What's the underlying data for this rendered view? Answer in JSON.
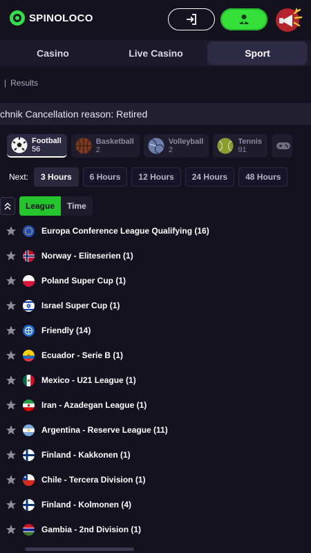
{
  "header": {
    "brand": "SPINOLOCO"
  },
  "nav": {
    "tabs": [
      {
        "label": "Casino"
      },
      {
        "label": "Live Casino"
      },
      {
        "label": "Sport"
      }
    ],
    "active": "Sport"
  },
  "breadcrumb": {
    "prev": "",
    "sep": "|",
    "current": "Results"
  },
  "ticker": {
    "text": "chnik Cancellation reason: Retired"
  },
  "sports": [
    {
      "name": "Football",
      "count": "56",
      "icon": "football-icon"
    },
    {
      "name": "Basketball",
      "count": "2",
      "icon": "basketball-icon"
    },
    {
      "name": "Volleyball",
      "count": "2",
      "icon": "volleyball-icon"
    },
    {
      "name": "Tennis",
      "count": "91",
      "icon": "tennis-icon"
    }
  ],
  "filter": {
    "next_label": "Next:",
    "options": [
      "3 Hours",
      "6 Hours",
      "12 Hours",
      "24 Hours",
      "48 Hours"
    ],
    "active": "3 Hours"
  },
  "sort": {
    "options": [
      "League",
      "Time"
    ],
    "active": "League"
  },
  "leagues": [
    {
      "name": "Europa Conference League Qualifying (16)",
      "flag": "eu-flag-icon"
    },
    {
      "name": "Norway - Eliteserien (1)",
      "flag": "norway-flag-icon"
    },
    {
      "name": "Poland Super Cup (1)",
      "flag": "poland-flag-icon"
    },
    {
      "name": "Israel Super Cup (1)",
      "flag": "israel-flag-icon"
    },
    {
      "name": "Friendly (14)",
      "flag": "world-icon"
    },
    {
      "name": "Ecuador - Serie B (1)",
      "flag": "ecuador-flag-icon"
    },
    {
      "name": "Mexico - U21 League (1)",
      "flag": "mexico-flag-icon"
    },
    {
      "name": "Iran - Azadegan League (1)",
      "flag": "iran-flag-icon"
    },
    {
      "name": "Argentina - Reserve League (11)",
      "flag": "argentina-flag-icon"
    },
    {
      "name": "Finland - Kakkonen (1)",
      "flag": "finland-flag-icon"
    },
    {
      "name": "Chile - Tercera Division (1)",
      "flag": "chile-flag-icon"
    },
    {
      "name": "Finland - Kolmonen (4)",
      "flag": "finland-flag-icon"
    },
    {
      "name": "Gambia - 2nd Division (1)",
      "flag": "gambia-flag-icon"
    }
  ],
  "colors": {
    "accent": "#35e038",
    "bg": "#15121f",
    "panel": "#1d1a2c"
  }
}
